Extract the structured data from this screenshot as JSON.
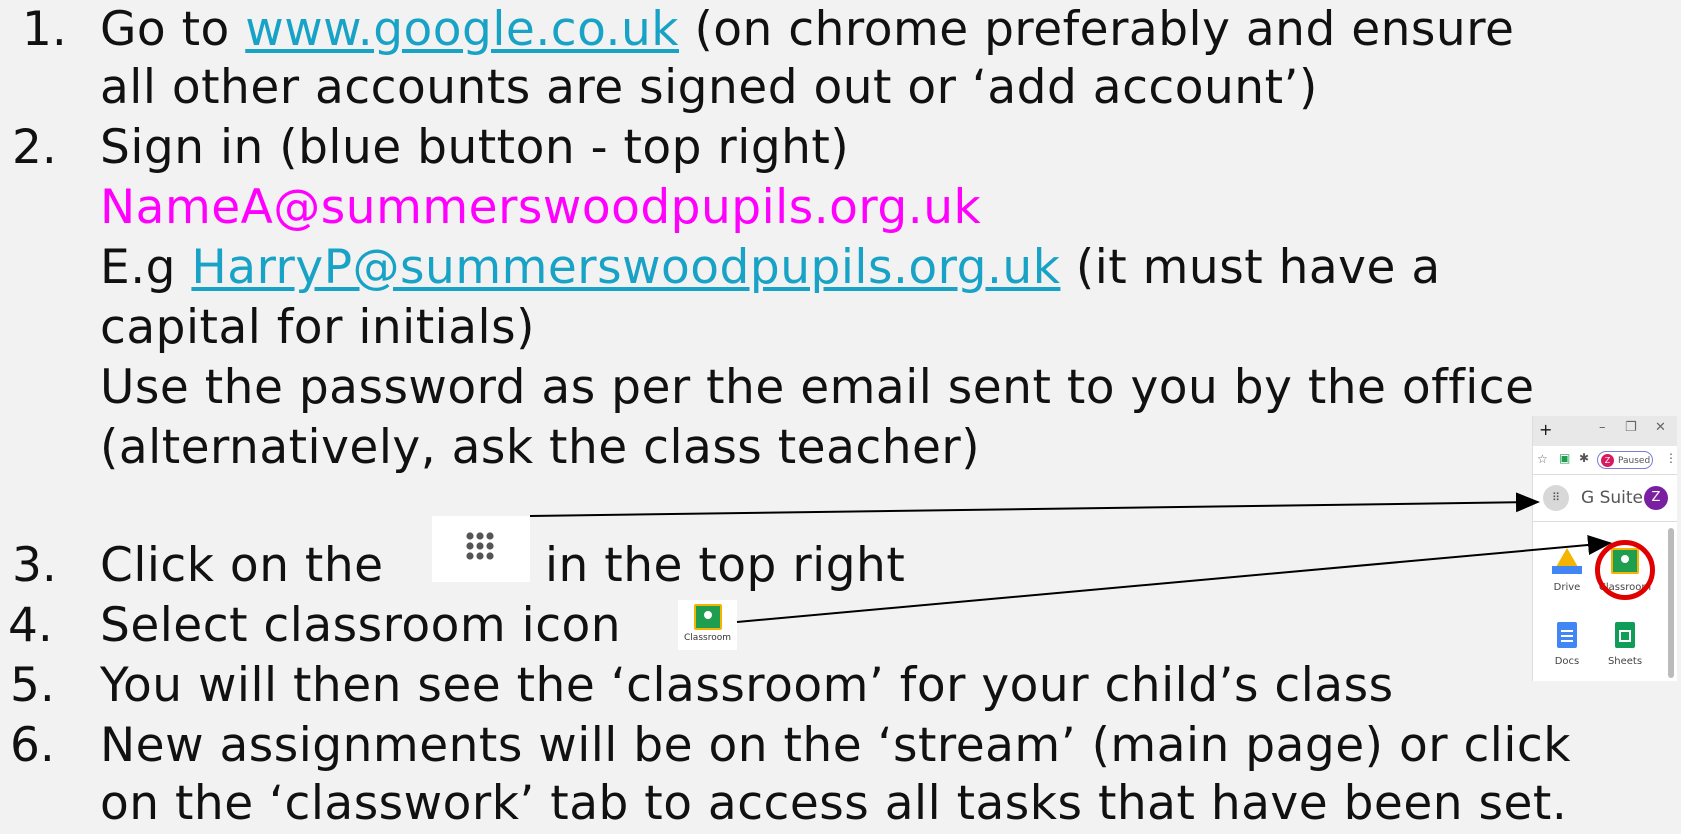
{
  "steps": [
    {
      "num": "1.",
      "text_a": "Go to ",
      "link": "www.google.co.uk",
      "text_b": " (on chrome preferably and ensure"
    },
    {
      "cont": "all other accounts are signed out or ‘add account’)"
    },
    {
      "num": "2.",
      "text": "Sign in (blue button - top right)"
    },
    {
      "email_format": "NameA@summerswoodpupils.org.uk"
    },
    {
      "eg_prefix": "E.g ",
      "eg_link": "HarryP@summerswoodpupils.org.uk",
      "eg_suffix": " (it must have a"
    },
    {
      "cont": "capital for initials)"
    },
    {
      "cont": "Use the password as per the email sent to you by the office"
    },
    {
      "cont": "(alternatively, ask the class teacher)"
    },
    {
      "num": "3.",
      "text_a": "Click on the ",
      "text_b": " in the top right"
    },
    {
      "num": "4.",
      "text": "Select classroom icon"
    },
    {
      "num": "5.",
      "text": "You will then see the ‘classroom’ for your child’s class"
    },
    {
      "num": "6.",
      "text": "New assignments will be on the ‘stream’ (main page) or click"
    },
    {
      "cont": "on the ‘classwork’ tab to access all tasks that have been set."
    }
  ],
  "icons": {
    "grid": "apps-grid-icon",
    "classroom_label": "Classroom"
  },
  "panel": {
    "paused": "Paused",
    "gsuite": "G Suite",
    "avatar": "Z",
    "apps": [
      {
        "label": "Drive"
      },
      {
        "label": "Classroom"
      },
      {
        "label": "Docs"
      },
      {
        "label": "Sheets"
      }
    ]
  },
  "colors": {
    "link": "#18a3c6",
    "highlight": "#ff00ff",
    "circle": "#e00000"
  }
}
